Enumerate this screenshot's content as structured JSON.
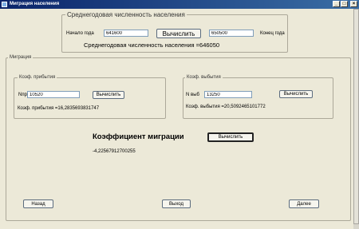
{
  "window": {
    "title": "Миграция населения",
    "minimize": "_",
    "maximize": "□",
    "close": "×"
  },
  "avg_population": {
    "group_title": "Среднегодовая численность населения",
    "start_label": "Начало года",
    "start_value": "641600",
    "calc_button": "Вычислить",
    "end_value": "650500",
    "end_label": "Конец года",
    "result_text": "Среднегодовая численность населения =646050"
  },
  "migration": {
    "group_title": "Миграция",
    "arrival": {
      "group_title": "Коэф. прибытия",
      "field_label": "Nпр",
      "field_value": "10520",
      "calc_button": "Вычислить",
      "result_text": "Коэф. прибытия =16,2835693831747"
    },
    "departure": {
      "group_title": "Коэф. выбытия",
      "field_label": "N выб",
      "field_value": "13250",
      "calc_button": "Вычислить",
      "result_text": "Коэф. выбытия =20,5092465101772"
    },
    "coef_title": "Коэффициент миграции",
    "coef_button": "Вычислить",
    "coef_result": "-4,22567912700255",
    "nav": {
      "back": "Назад",
      "exit": "Выход",
      "next": "Далее"
    }
  }
}
